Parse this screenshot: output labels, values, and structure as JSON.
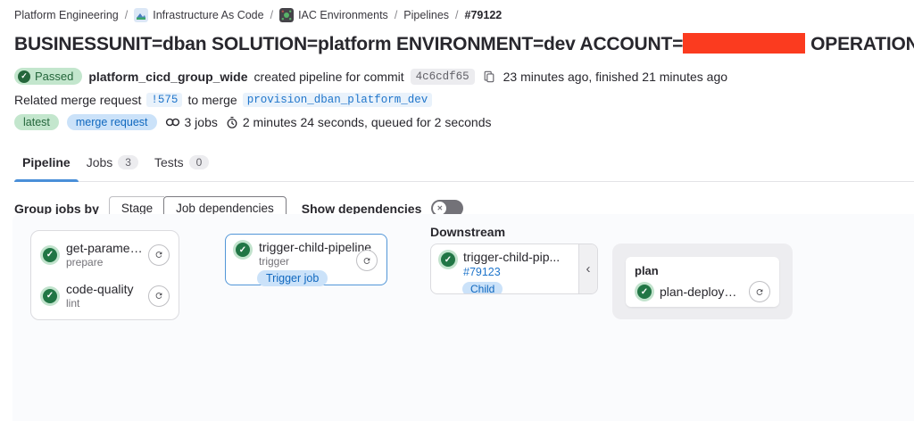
{
  "icons": {
    "check": "✓",
    "toggle_x": "✕",
    "chevron_collapse": "‹"
  },
  "breadcrumb": {
    "separator": "/",
    "items": [
      {
        "label": "Platform Engineering"
      },
      {
        "label": "Infrastructure As Code"
      },
      {
        "label": "IAC Environments"
      },
      {
        "label": "Pipelines"
      },
      {
        "label": "#79122"
      }
    ]
  },
  "header": {
    "title_prefix": "BUSINESSUNIT=dban SOLUTION=platform ENVIRONMENT=dev ACCOUNT=",
    "title_suffix": "OPERATION=update",
    "redaction_color": "#fb3b1f"
  },
  "status_line": {
    "badge": "Passed",
    "user": "platform_cicd_group_wide",
    "action": "created pipeline for commit",
    "commit_sha": "4c6cdf65",
    "timing": "23 minutes ago, finished 21 minutes ago"
  },
  "related_mr": {
    "prefix": "Related merge request",
    "mr_ref": "!575",
    "middle": "to merge",
    "branch": "provision_dban_platform_dev"
  },
  "meta_line": {
    "badges": [
      "latest",
      "merge request"
    ],
    "jobs_count": "3 jobs",
    "duration": "2 minutes 24 seconds, queued for 2 seconds"
  },
  "tabs": [
    {
      "label": "Pipeline"
    },
    {
      "label": "Jobs",
      "count": "3"
    },
    {
      "label": "Tests",
      "count": "0"
    }
  ],
  "controls": {
    "group_label": "Group jobs by",
    "options": [
      "Stage",
      "Job dependencies"
    ],
    "selected": "Job dependencies",
    "toggle_label": "Show dependencies",
    "toggle_state": "off"
  },
  "graph": {
    "stage1_jobs": [
      {
        "name": "get-parameters",
        "stage": "prepare",
        "status": "passed"
      },
      {
        "name": "code-quality",
        "stage": "lint",
        "status": "passed"
      }
    ],
    "trigger_job": {
      "name": "trigger-child-pipeline",
      "stage": "trigger",
      "badge": "Trigger job",
      "status": "passed"
    },
    "downstream": {
      "label": "Downstream",
      "pipeline_name": "trigger-child-pip...",
      "pipeline_id": "#79123",
      "badge": "Child",
      "status": "passed"
    },
    "child_stage": {
      "name": "plan",
      "job": {
        "name": "plan-deployment",
        "status": "passed"
      }
    }
  },
  "colors": {
    "accent_blue": "#1f75cb",
    "success_green": "#217645",
    "graph_bg": "#fafbfd"
  }
}
